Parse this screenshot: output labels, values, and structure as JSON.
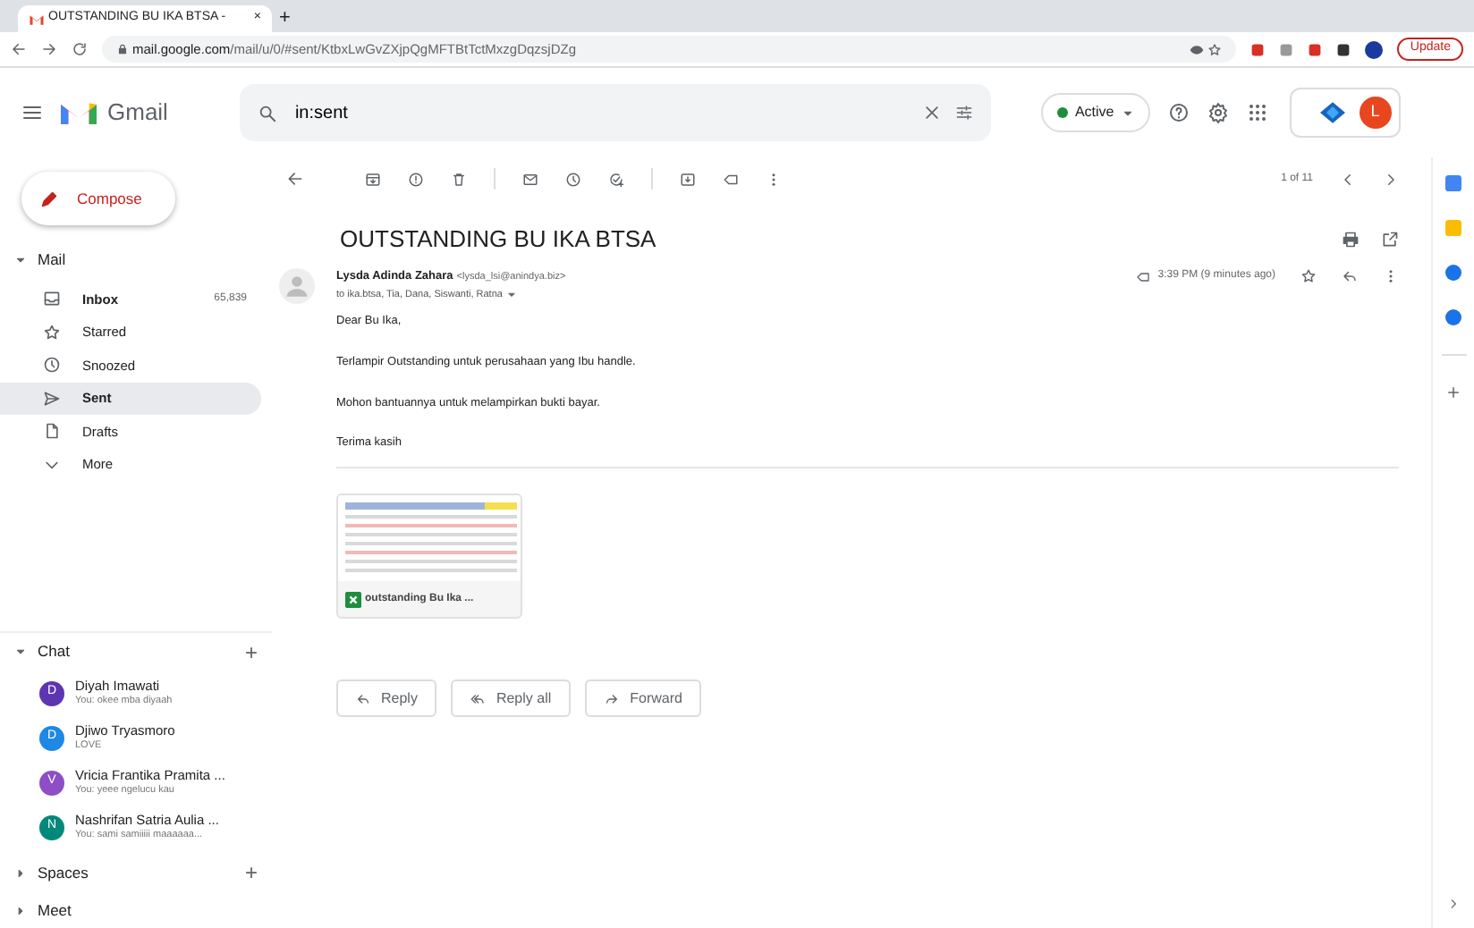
{
  "browser": {
    "tab_title": "OUTSTANDING BU IKA BTSA -",
    "tab_close": "×",
    "new_tab": "+",
    "url_host": "mail.google.com",
    "url_path": "/mail/u/0/#sent/KtbxLwGvZXjpQgMFTBtTctMxzgDqzsjDZg",
    "update_button": "Update"
  },
  "header": {
    "app_name": "Gmail",
    "search": {
      "value": "in:sent"
    },
    "status": {
      "label": "Active",
      "color": "#1e8e3e"
    },
    "avatar": "L"
  },
  "compose": "Compose",
  "mail_section": {
    "label": "Mail",
    "expanded": true,
    "items": [
      {
        "label": "Inbox",
        "count": "65,839",
        "selected": false,
        "bold": true
      },
      {
        "label": "Starred",
        "selected": false,
        "bold": false
      },
      {
        "label": "Snoozed",
        "selected": false,
        "bold": false
      },
      {
        "label": "Sent",
        "selected": true,
        "bold": true
      },
      {
        "label": "Drafts",
        "selected": false,
        "bold": false
      },
      {
        "label": "More",
        "selected": false,
        "bold": false
      }
    ]
  },
  "chat_section": {
    "label": "Chat",
    "expanded": true,
    "add": "+",
    "contacts": [
      {
        "initial": "D",
        "name": "Diyah Imawati",
        "preview": "You: okee mba diyaah",
        "color": "#5e35b1"
      },
      {
        "initial": "D",
        "name": "Djiwo Tryasmoro",
        "preview": "LOVE",
        "color": "#1e88e5"
      },
      {
        "initial": "V",
        "name": "Vricia Frantika Pramita ...",
        "preview": "You: yeee ngelucu kau",
        "color": "#8e4fc6"
      },
      {
        "initial": "N",
        "name": "Nashrifan Satria Aulia ...",
        "preview": "You: sami samiiiii maaaaaa...",
        "color": "#00897b"
      }
    ]
  },
  "spaces_section": {
    "label": "Spaces",
    "expanded": false,
    "add": "+"
  },
  "meet_section": {
    "label": "Meet",
    "expanded": false
  },
  "pager": "1 of 11",
  "email": {
    "subject": "OUTSTANDING BU IKA BTSA",
    "sender_name": "Lysda Adinda Zahara",
    "sender_email": "<lysda_lsi@anindya.biz>",
    "recipients": "to ika.btsa, Tia, Dana, Siswanti, Ratna",
    "time": "3:39 PM (9 minutes ago)",
    "starred": false,
    "body": [
      "Dear Bu Ika,",
      "Terlampir Outstanding untuk perusahaan yang Ibu handle.",
      "Mohon bantuannya untuk melampirkan bukti bayar.",
      "Terima kasih"
    ],
    "attachment": {
      "name": "outstanding Bu Ika ..."
    }
  },
  "actions": [
    "Reply",
    "Reply all",
    "Forward"
  ]
}
